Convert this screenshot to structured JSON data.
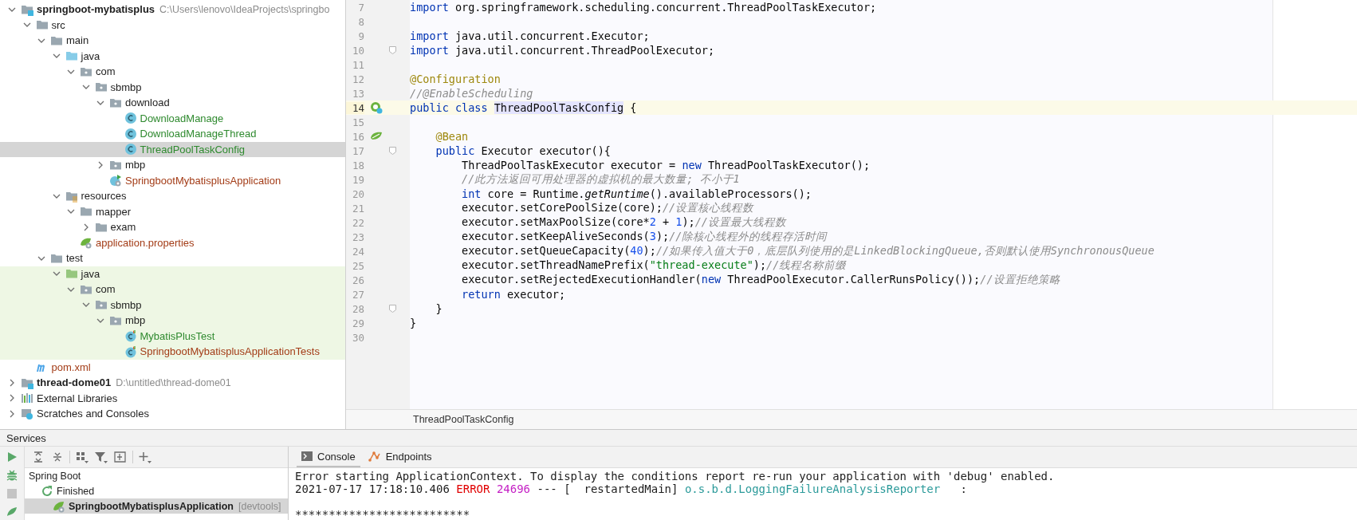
{
  "project_tree": [
    {
      "kind": "module",
      "label": "springboot-mybatisplus",
      "hint": "C:\\Users\\lenovo\\IdeaProjects\\springbo",
      "expanded": true,
      "selected": false,
      "children": [
        {
          "kind": "folder",
          "label": "src",
          "expanded": true,
          "selected": false,
          "children": [
            {
              "kind": "folder",
              "label": "main",
              "expanded": true,
              "selected": false,
              "children": [
                {
                  "kind": "source-root",
                  "label": "java",
                  "expanded": true,
                  "selected": false,
                  "children": [
                    {
                      "kind": "package",
                      "label": "com",
                      "expanded": true,
                      "selected": false,
                      "children": [
                        {
                          "kind": "package",
                          "label": "sbmbp",
                          "expanded": true,
                          "selected": false,
                          "children": [
                            {
                              "kind": "package",
                              "label": "download",
                              "expanded": true,
                              "selected": false,
                              "children": [
                                {
                                  "kind": "class",
                                  "label": "DownloadManage",
                                  "color": "#2f8a2f",
                                  "selected": false
                                },
                                {
                                  "kind": "class",
                                  "label": "DownloadManageThread",
                                  "color": "#2f8a2f",
                                  "selected": false
                                },
                                {
                                  "kind": "class",
                                  "label": "ThreadPoolTaskConfig",
                                  "color": "#2f8a2f",
                                  "selected": true
                                }
                              ]
                            },
                            {
                              "kind": "package",
                              "label": "mbp",
                              "expanded": false,
                              "selected": false
                            },
                            {
                              "kind": "spring-class",
                              "label": "SpringbootMybatisplusApplication",
                              "color": "#a33c17",
                              "selected": false
                            }
                          ]
                        }
                      ]
                    }
                  ]
                },
                {
                  "kind": "resources-root",
                  "label": "resources",
                  "expanded": true,
                  "selected": false,
                  "children": [
                    {
                      "kind": "folder",
                      "label": "mapper",
                      "expanded": true,
                      "selected": false,
                      "children": [
                        {
                          "kind": "folder",
                          "label": "exam",
                          "expanded": false,
                          "selected": false
                        }
                      ]
                    },
                    {
                      "kind": "properties",
                      "label": "application.properties",
                      "color": "#a33c17",
                      "selected": false
                    }
                  ]
                }
              ]
            },
            {
              "kind": "folder",
              "label": "test",
              "expanded": true,
              "selected": false,
              "children": [
                {
                  "kind": "test-root",
                  "label": "java",
                  "expanded": true,
                  "selected": false,
                  "children": [
                    {
                      "kind": "package",
                      "label": "com",
                      "expanded": true,
                      "selected": false,
                      "children": [
                        {
                          "kind": "package",
                          "label": "sbmbp",
                          "expanded": true,
                          "selected": false,
                          "children": [
                            {
                              "kind": "package",
                              "label": "mbp",
                              "expanded": true,
                              "selected": false,
                              "children": [
                                {
                                  "kind": "test-class",
                                  "label": "MybatisPlusTest",
                                  "color": "#2f8a2f",
                                  "selected": false
                                },
                                {
                                  "kind": "test-class",
                                  "label": "SpringbootMybatisplusApplicationTests",
                                  "color": "#a33c17",
                                  "selected": false
                                }
                              ]
                            }
                          ]
                        }
                      ]
                    }
                  ]
                }
              ]
            }
          ]
        },
        {
          "kind": "maven",
          "label": "pom.xml",
          "color": "#a33c17",
          "selected": false
        }
      ]
    },
    {
      "kind": "module",
      "label": "thread-dome01",
      "hint": "D:\\untitled\\thread-dome01",
      "expanded": false,
      "selected": false
    },
    {
      "kind": "libraries",
      "label": "External Libraries",
      "expanded": false,
      "selected": false
    },
    {
      "kind": "scratches",
      "label": "Scratches and Consoles",
      "expanded": false,
      "selected": false
    }
  ],
  "editor": {
    "lines": [
      {
        "number": "7",
        "current": false,
        "fold": false,
        "tokens": [
          {
            "kind": "keyword",
            "text": "import"
          },
          {
            "kind": "plain",
            "text": " org.springframework.scheduling.concurrent.ThreadPoolTaskExecutor;"
          }
        ]
      },
      {
        "number": "8",
        "current": false,
        "fold": false
      },
      {
        "number": "9",
        "current": false,
        "fold": false,
        "tokens": [
          {
            "kind": "keyword",
            "text": "import"
          },
          {
            "kind": "plain",
            "text": " java.util.concurrent.Executor;"
          }
        ]
      },
      {
        "number": "10",
        "current": false,
        "fold": true,
        "tokens": [
          {
            "kind": "keyword",
            "text": "import"
          },
          {
            "kind": "plain",
            "text": " java.util.concurrent.ThreadPoolExecutor;"
          }
        ]
      },
      {
        "number": "11",
        "current": false,
        "fold": false
      },
      {
        "number": "12",
        "current": false,
        "fold": false,
        "tokens": [
          {
            "kind": "annotation",
            "text": "@Configuration"
          }
        ]
      },
      {
        "number": "13",
        "current": false,
        "fold": false,
        "tokens": [
          {
            "kind": "comment",
            "text": "//@EnableScheduling"
          }
        ]
      },
      {
        "number": "14",
        "current": true,
        "fold": false,
        "kind": "bean-class",
        "tokens": [
          {
            "kind": "keyword",
            "text": "public class "
          },
          {
            "kind": "usage",
            "text": "ThreadPoolTaskConfig"
          },
          {
            "kind": "plain",
            "text": " {"
          }
        ]
      },
      {
        "number": "15",
        "current": false,
        "fold": false
      },
      {
        "number": "16",
        "current": false,
        "fold": false,
        "kind": "bean-method",
        "tokens": [
          {
            "kind": "annotation",
            "text": "    @Bean"
          }
        ]
      },
      {
        "number": "17",
        "current": false,
        "fold": true,
        "tokens": [
          {
            "kind": "keyword",
            "text": "    public"
          },
          {
            "kind": "plain",
            "text": " Executor executor(){"
          }
        ]
      },
      {
        "number": "18",
        "current": false,
        "fold": false,
        "tokens": [
          {
            "kind": "plain",
            "text": "        ThreadPoolTaskExecutor executor = "
          },
          {
            "kind": "keyword",
            "text": "new"
          },
          {
            "kind": "plain",
            "text": " ThreadPoolTaskExecutor();"
          }
        ]
      },
      {
        "number": "19",
        "current": false,
        "fold": false,
        "tokens": [
          {
            "kind": "comment",
            "text": "        //此方法返回可用处理器的虚拟机的最大数量; 不小于1"
          }
        ]
      },
      {
        "number": "20",
        "current": false,
        "fold": false,
        "tokens": [
          {
            "kind": "keyword",
            "text": "        int"
          },
          {
            "kind": "plain",
            "text": " core = Runtime."
          },
          {
            "kind": "static",
            "text": "getRuntime"
          },
          {
            "kind": "plain",
            "text": "().availableProcessors();"
          }
        ]
      },
      {
        "number": "21",
        "current": false,
        "fold": false,
        "tokens": [
          {
            "kind": "plain",
            "text": "        executor.setCorePoolSize(core);"
          },
          {
            "kind": "comment",
            "text": "//设置核心线程数"
          }
        ]
      },
      {
        "number": "22",
        "current": false,
        "fold": false,
        "tokens": [
          {
            "kind": "plain",
            "text": "        executor.setMaxPoolSize(core*"
          },
          {
            "kind": "number",
            "text": "2"
          },
          {
            "kind": "plain",
            "text": " + "
          },
          {
            "kind": "number",
            "text": "1"
          },
          {
            "kind": "plain",
            "text": ");"
          },
          {
            "kind": "comment",
            "text": "//设置最大线程数"
          }
        ]
      },
      {
        "number": "23",
        "current": false,
        "fold": false,
        "tokens": [
          {
            "kind": "plain",
            "text": "        executor.setKeepAliveSeconds("
          },
          {
            "kind": "number",
            "text": "3"
          },
          {
            "kind": "plain",
            "text": ");"
          },
          {
            "kind": "comment",
            "text": "//除核心线程外的线程存活时间"
          }
        ]
      },
      {
        "number": "24",
        "current": false,
        "fold": false,
        "tokens": [
          {
            "kind": "plain",
            "text": "        executor.setQueueCapacity("
          },
          {
            "kind": "number",
            "text": "40"
          },
          {
            "kind": "plain",
            "text": ");"
          },
          {
            "kind": "comment",
            "text": "//如果传入值大于0，底层队列使用的是LinkedBlockingQueue,否则默认使用SynchronousQueue"
          }
        ]
      },
      {
        "number": "25",
        "current": false,
        "fold": false,
        "tokens": [
          {
            "kind": "plain",
            "text": "        executor.setThreadNamePrefix("
          },
          {
            "kind": "string",
            "text": "\"thread-execute\""
          },
          {
            "kind": "plain",
            "text": ");"
          },
          {
            "kind": "comment",
            "text": "//线程名称前缀"
          }
        ]
      },
      {
        "number": "26",
        "current": false,
        "fold": false,
        "tokens": [
          {
            "kind": "plain",
            "text": "        executor.setRejectedExecutionHandler("
          },
          {
            "kind": "keyword",
            "text": "new"
          },
          {
            "kind": "plain",
            "text": " ThreadPoolExecutor.CallerRunsPolicy());"
          },
          {
            "kind": "comment",
            "text": "//设置拒绝策略"
          }
        ]
      },
      {
        "number": "27",
        "current": false,
        "fold": false,
        "tokens": [
          {
            "kind": "keyword",
            "text": "        return"
          },
          {
            "kind": "plain",
            "text": " executor;"
          }
        ]
      },
      {
        "number": "28",
        "current": false,
        "fold": true,
        "tokens": [
          {
            "kind": "plain",
            "text": "    }"
          }
        ]
      },
      {
        "number": "29",
        "current": false,
        "fold": false,
        "tokens": [
          {
            "kind": "plain",
            "text": "}"
          }
        ]
      },
      {
        "number": "30",
        "current": false,
        "fold": false
      }
    ],
    "breadcrumb": "ThreadPoolTaskConfig"
  },
  "services": {
    "title": "Services",
    "tree": [
      {
        "kind": "group",
        "label": "Spring Boot",
        "selected": false,
        "children": [
          {
            "kind": "finished",
            "label": "Finished",
            "selected": false,
            "children": [
              {
                "kind": "app",
                "label": "SpringbootMybatisplusApplication",
                "hint": "[devtools]",
                "selected": true
              }
            ]
          }
        ]
      }
    ],
    "tabs": [
      {
        "kind": "console",
        "label": "Console",
        "selected": true
      },
      {
        "kind": "endpoints",
        "label": "Endpoints",
        "selected": false
      }
    ],
    "console": [
      {
        "tokens": [
          {
            "kind": "plain",
            "text": "Error starting ApplicationContext. To display the conditions report re-run your application with 'debug' enabled."
          }
        ]
      },
      {
        "tokens": [
          {
            "kind": "plain",
            "text": "2021-07-17 17:18:10.406 "
          },
          {
            "kind": "error",
            "text": "ERROR"
          },
          {
            "kind": "pid",
            "text": " 24696"
          },
          {
            "kind": "plain",
            "text": " --- [  restartedMain] "
          },
          {
            "kind": "logger",
            "text": "o.s.b.d.LoggingFailureAnalysisReporter"
          },
          {
            "kind": "plain",
            "text": "   :"
          }
        ]
      },
      {
        "blank_before": true,
        "tokens": [
          {
            "kind": "plain",
            "text": "**************************"
          }
        ]
      }
    ]
  }
}
